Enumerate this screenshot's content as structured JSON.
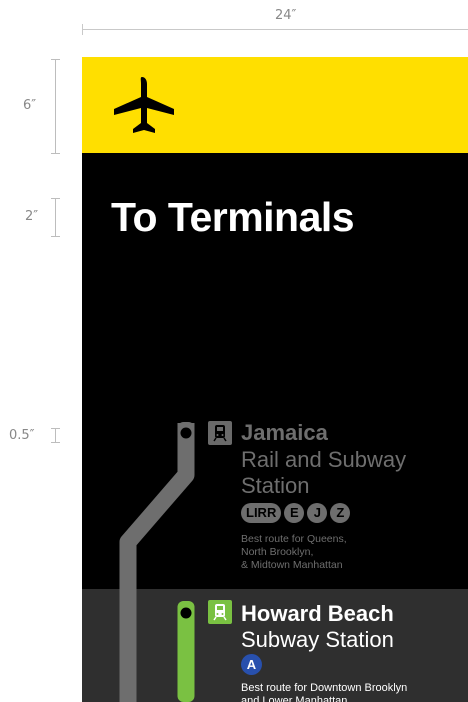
{
  "dimensions": {
    "width": "24″",
    "yellow_band": "6″",
    "title_height": "2″",
    "spacing": "0.5″"
  },
  "sign": {
    "icon": "airplane-icon",
    "title": "To Terminals",
    "colors": {
      "background": "#000000",
      "band": "#ffdf00",
      "text": "#ffffff",
      "muted": "#6e6e6e",
      "subway_green": "#7ac142",
      "a_line_blue": "#2850ad"
    }
  },
  "stations": [
    {
      "icon": "train-icon",
      "name": "Jamaica",
      "subtitle_line1": "Rail and Subway",
      "subtitle_line2": "Station",
      "lines": [
        "LIRR",
        "E",
        "J",
        "Z"
      ],
      "description": "Best route for Queens,\nNorth Brooklyn,\n& Midtown Manhattan"
    },
    {
      "icon": "subway-icon",
      "name": "Howard Beach",
      "subtitle": "Subway Station",
      "lines": [
        "A"
      ],
      "description": "Best route for Downtown Brooklyn\nand Lower Manhattan"
    }
  ]
}
